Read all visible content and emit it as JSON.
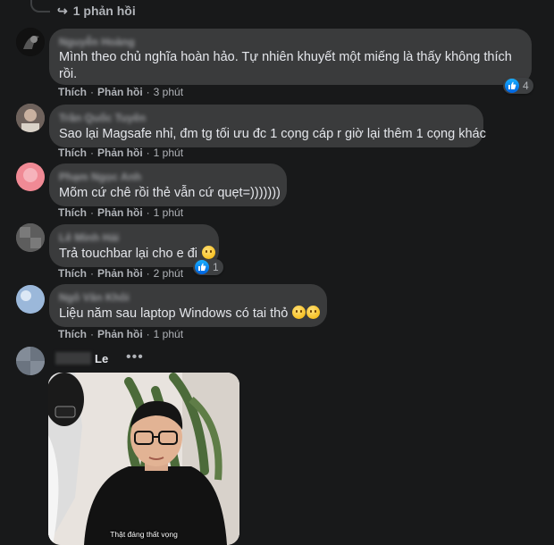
{
  "top_reply": {
    "label": "1 phản hồi"
  },
  "actions": {
    "like": "Thích",
    "reply": "Phản hồi"
  },
  "comments": [
    {
      "author": "Nguyễn Hoàng",
      "text": "Mình theo chủ nghĩa hoàn hảo. Tự nhiên khuyết một miếng là thấy không thích rồi.",
      "time": "3 phút",
      "likes": "4"
    },
    {
      "author": "Trần Quốc Tuyên",
      "text": "Sao lại Magsafe nhỉ, đm tg tối ưu đc 1 cọng cáp r giờ lại thêm 1 cọng khác",
      "time": "1 phút"
    },
    {
      "author": "Phạm Ngọc Anh",
      "text": "Mõm cứ chê rồi thẻ vẫn cứ quẹt=)))))))",
      "time": "1 phút"
    },
    {
      "author": "Lê Minh Hải",
      "text": "Trả touchbar lại cho e đi",
      "time": "2 phút",
      "likes": "1"
    },
    {
      "author": "Ngô Văn Khôi",
      "text": "Liệu năm sau laptop Windows có tai thỏ",
      "time": "1 phút"
    }
  ],
  "last_comment": {
    "author": "Le",
    "more": "•••",
    "caption": "Thật đáng thất vọng"
  },
  "colors": {
    "bg": "#18191a",
    "bubble": "#3a3b3c",
    "text": "#e4e6eb",
    "muted": "#b0b3b8",
    "like": "#1877f2"
  }
}
